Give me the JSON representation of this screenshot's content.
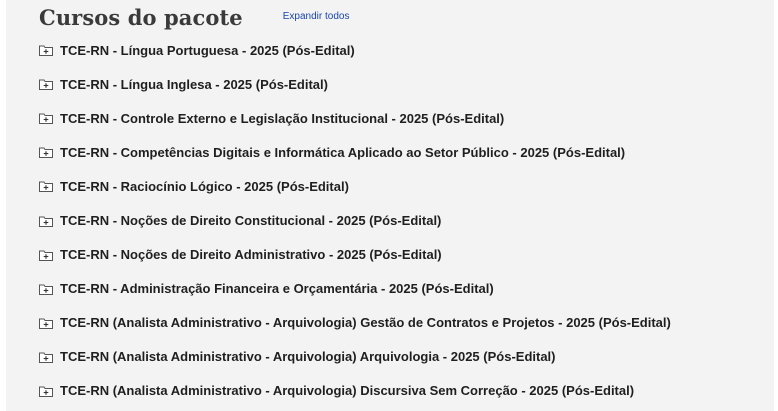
{
  "header": {
    "title": "Cursos do pacote",
    "expand_all": "Expandir todos"
  },
  "courses": [
    {
      "label": "TCE-RN - Língua Portuguesa - 2025 (Pós-Edital)",
      "icon": "folder-plus-icon"
    },
    {
      "label": "TCE-RN - Língua Inglesa - 2025 (Pós-Edital)",
      "icon": "folder-plus-icon"
    },
    {
      "label": "TCE-RN - Controle Externo e Legislação Institucional - 2025 (Pós-Edital)",
      "icon": "folder-plus-icon"
    },
    {
      "label": "TCE-RN - Competências Digitais e Informática Aplicado ao Setor Público - 2025 (Pós-Edital)",
      "icon": "folder-plus-icon"
    },
    {
      "label": "TCE-RN - Raciocínio Lógico - 2025 (Pós-Edital)",
      "icon": "folder-plus-icon"
    },
    {
      "label": "TCE-RN - Noções de Direito Constitucional - 2025 (Pós-Edital)",
      "icon": "folder-plus-icon"
    },
    {
      "label": "TCE-RN - Noções de Direito Administrativo - 2025 (Pós-Edital)",
      "icon": "folder-plus-icon"
    },
    {
      "label": "TCE-RN - Administração Financeira e Orçamentária - 2025 (Pós-Edital)",
      "icon": "folder-plus-icon"
    },
    {
      "label": "TCE-RN (Analista Administrativo - Arquivologia) Gestão de Contratos e Projetos - 2025 (Pós-Edital)",
      "icon": "folder-plus-icon"
    },
    {
      "label": "TCE-RN (Analista Administrativo - Arquivologia) Arquivologia - 2025 (Pós-Edital)",
      "icon": "folder-plus-icon"
    },
    {
      "label": "TCE-RN (Analista Administrativo - Arquivologia) Discursiva Sem Correção - 2025 (Pós-Edital)",
      "icon": "folder-plus-icon"
    }
  ],
  "colors": {
    "panel_background": "#f3f3f3",
    "link": "#1a44b0",
    "text": "#1f1f1f",
    "title": "#3a3a3a"
  }
}
